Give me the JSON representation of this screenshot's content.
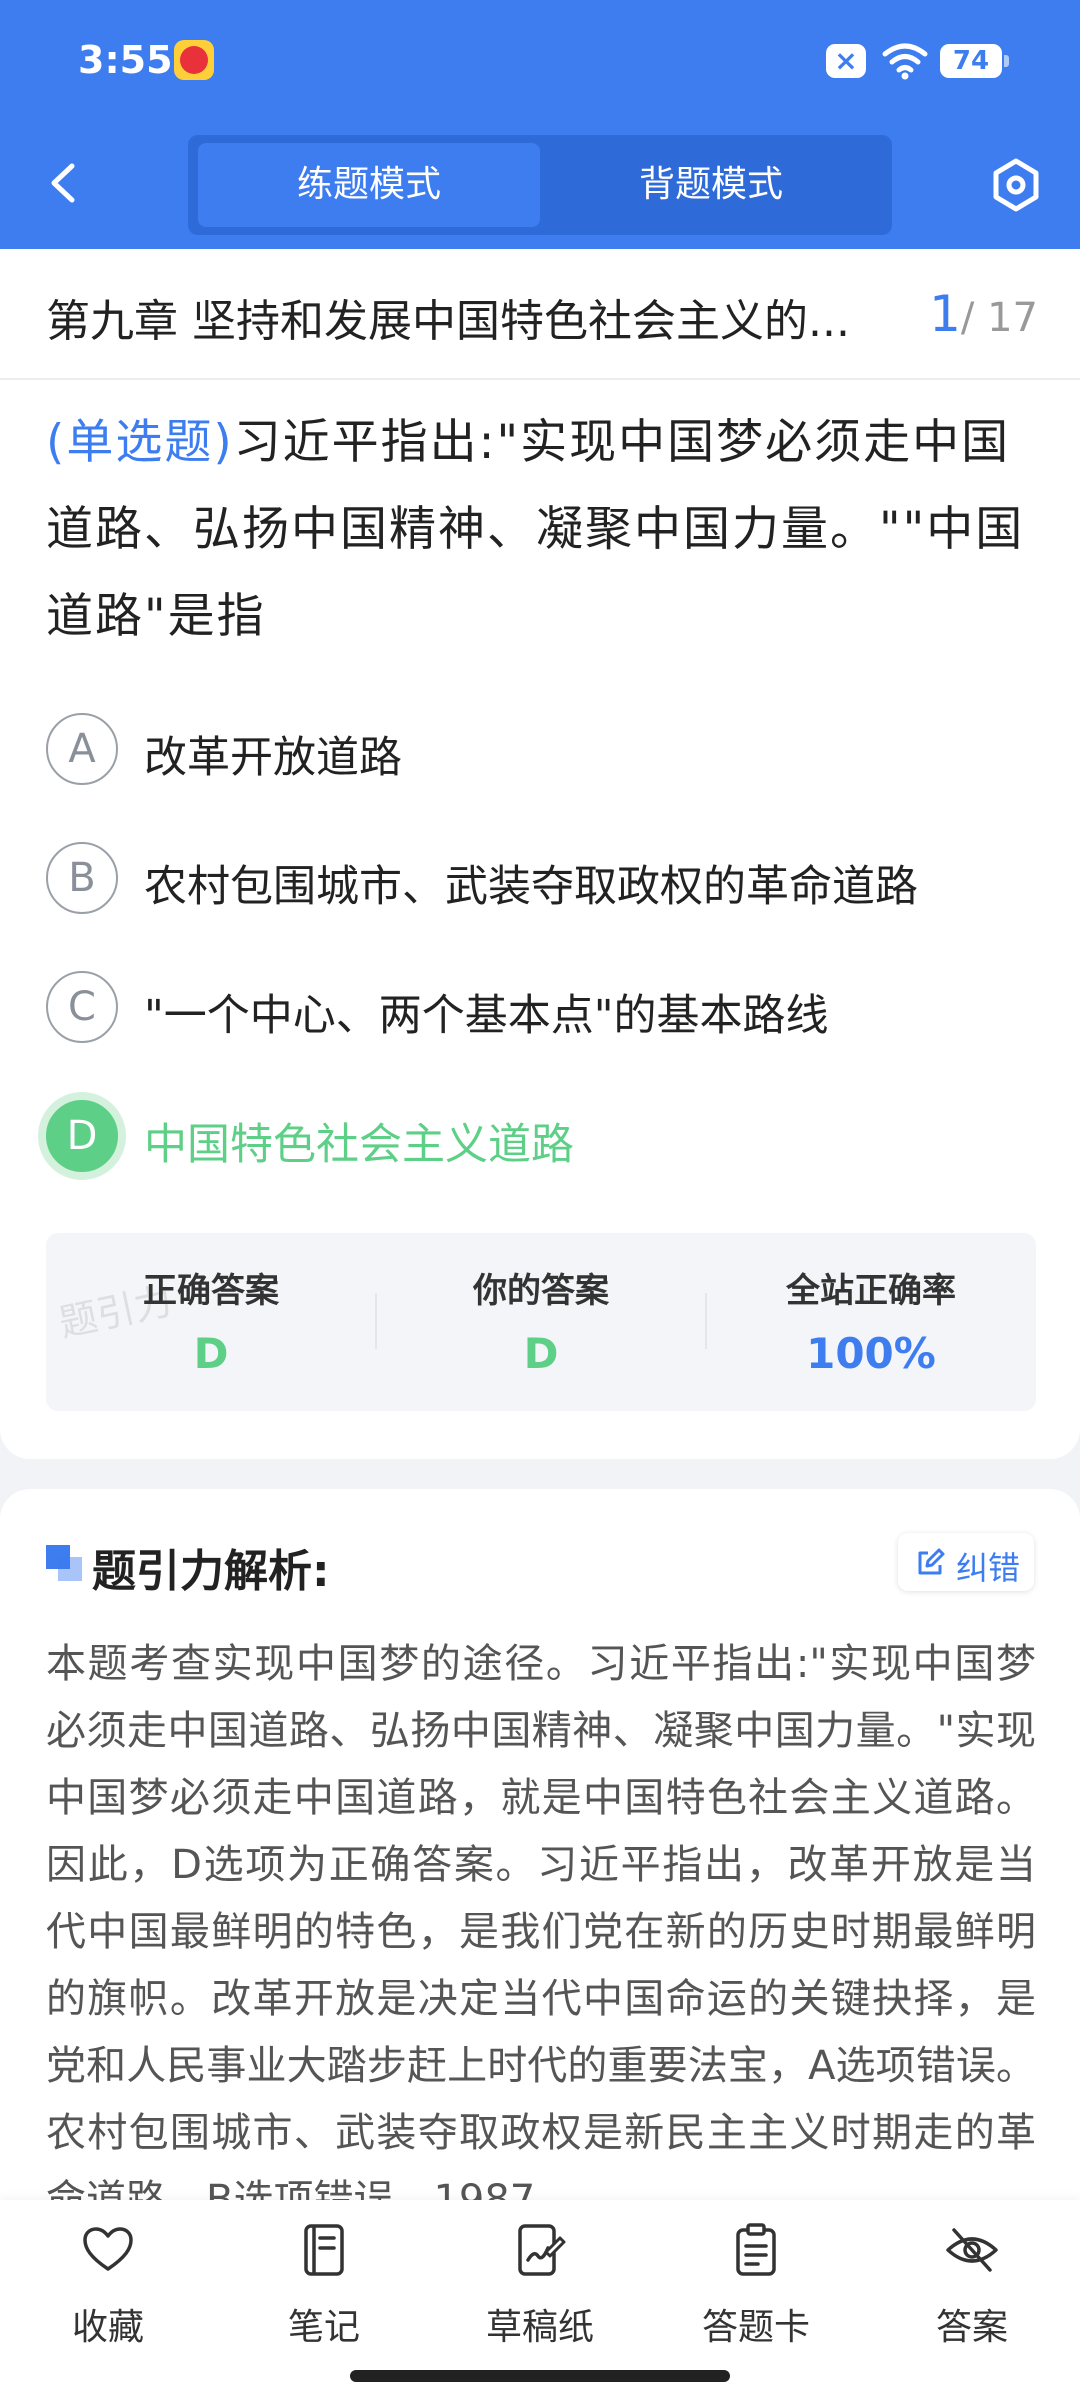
{
  "status_bar": {
    "time": "3:55",
    "battery": "74"
  },
  "header": {
    "modes": [
      {
        "label": "练题模式",
        "active": true
      },
      {
        "label": "背题模式",
        "active": false
      }
    ]
  },
  "question": {
    "chapter_title": "第九章 坚持和发展中国特色社会主义的...",
    "current": "1",
    "total": "/ 17",
    "type_label": "(单选题)",
    "text": "习近平指出:\"实现中国梦必须走中国道路、弘扬中国精神、凝聚中国力量。\"\"中国道路\"是指",
    "options": [
      {
        "key": "A",
        "text": "改革开放道路",
        "selected": false
      },
      {
        "key": "B",
        "text": "农村包围城市、武装夺取政权的革命道路",
        "selected": false
      },
      {
        "key": "C",
        "text": "\"一个中心、两个基本点\"的基本路线",
        "selected": false
      },
      {
        "key": "D",
        "text": "中国特色社会主义道路",
        "selected": true
      }
    ]
  },
  "answer_panel": {
    "watermark": "题引力",
    "correct_label": "正确答案",
    "correct_value": "D",
    "yours_label": "你的答案",
    "yours_value": "D",
    "rate_label": "全站正确率",
    "rate_value": "100%"
  },
  "analysis": {
    "title": "题引力解析:",
    "report_label": "纠错",
    "text": "本题考查实现中国梦的途径。习近平指出:\"实现中国梦必须走中国道路、弘扬中国精神、凝聚中国力量。\"实现中国梦必须走中国道路，就是中国特色社会主义道路。因此，D选项为正确答案。习近平指出，改革开放是当代中国最鲜明的特色，是我们党在新的历史时期最鲜明的旗帜。改革开放是决定当代中国命运的关键抉择，是党和人民事业大踏步赶上时代的重要法宝，A选项错误。农村包围城市、武装夺取政权是新民主主义时期走的革命道路，B选项错误。1987"
  },
  "bottom_bar": [
    {
      "label": "收藏",
      "icon": "heart-icon"
    },
    {
      "label": "笔记",
      "icon": "notebook-icon"
    },
    {
      "label": "草稿纸",
      "icon": "draft-paper-icon"
    },
    {
      "label": "答题卡",
      "icon": "answer-sheet-icon"
    },
    {
      "label": "答案",
      "icon": "eye-off-icon"
    }
  ],
  "colors": {
    "primary": "#3d7df0",
    "correct": "#5dcf86"
  }
}
